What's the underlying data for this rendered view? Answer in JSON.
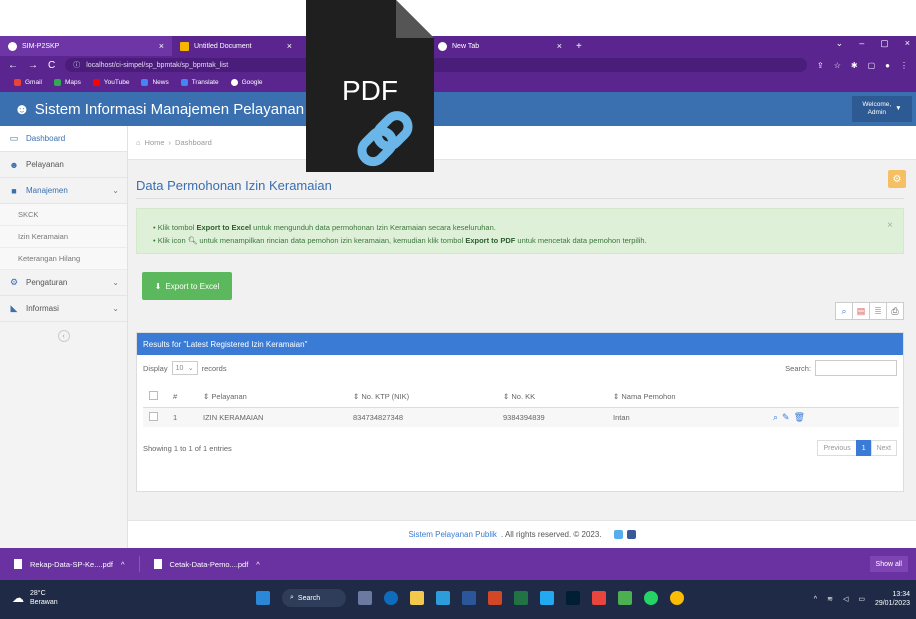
{
  "browser": {
    "tabs": [
      {
        "label": "SIM-P2SKP",
        "close": "×"
      },
      {
        "label": "Untitled Document",
        "close": "×"
      },
      {
        "label": "New Tab",
        "close": "×"
      }
    ],
    "new_tab": "+",
    "address": "localhost/ci-simpel/sp_bpmtak/sp_bpmtak_list",
    "address_host": "localhost",
    "window_controls": [
      "⌄",
      "–",
      "▢",
      "×"
    ],
    "bookmarks": [
      {
        "label": "Gmail",
        "color": "#ea4335"
      },
      {
        "label": "Maps",
        "color": "#34a853"
      },
      {
        "label": "YouTube",
        "color": "#ff0000"
      },
      {
        "label": "News",
        "color": "#4285f4"
      },
      {
        "label": "Translate",
        "color": "#4285f4"
      },
      {
        "label": "Google",
        "color": "#ffffff"
      }
    ]
  },
  "overlay": {
    "text": "PDF"
  },
  "header": {
    "title": "Sistem Informasi Manajemen Pelayanan Pelaya",
    "welcome": "Welcome,",
    "user": "Admin"
  },
  "sidebar": {
    "items": [
      {
        "label": "Dashboard"
      },
      {
        "label": "Pelayanan"
      },
      {
        "label": "Manajemen"
      },
      {
        "label": "Pengaturan"
      },
      {
        "label": "Informasi"
      }
    ],
    "subitems": [
      "SKCK",
      "Izin Keramaian",
      "Keterangan Hilang"
    ]
  },
  "breadcrumb": {
    "home": "Home",
    "sep": "›",
    "current": "Dashboard"
  },
  "page": {
    "title": "Data Permohonan Izin Keramaian"
  },
  "alert": {
    "line1_pre": "Klik tombol ",
    "line1_bold": "Export to Excel",
    "line1_post": " untuk mengunduh data permohonan Izin Keramaian secara keseluruhan.",
    "line2_pre": "Klik icon ",
    "line2_mid": " untuk menampilkan rincian data pemohon izin keramaian, kemudian klik tombol ",
    "line2_bold": "Export to PDF",
    "line2_post": " untuk mencetak data pemohon terpilih.",
    "close": "×"
  },
  "export_button": "Export to Excel",
  "results_title": "Results for \"Latest Registered Izin Keramaian\"",
  "controls": {
    "display": "Display",
    "records_count": "10",
    "records": "records",
    "search": "Search:"
  },
  "table": {
    "headers": [
      "#",
      "Pelayanan",
      "No. KTP (NIK)",
      "No. KK",
      "Nama Pemohon"
    ],
    "rows": [
      {
        "num": "1",
        "pelayanan": "IZIN KERAMAIAN",
        "ktp": "834734827348",
        "kk": "9384394839",
        "nama": "Intan"
      }
    ]
  },
  "info": "Showing 1 to 1 of 1 entries",
  "pager": {
    "prev": "Previous",
    "current": "1",
    "next": "Next"
  },
  "footer": {
    "brand": "Sistem Pelayanan Publik",
    "text": ". All rights reserved. © 2023."
  },
  "downloads": [
    {
      "label": "Rekap-Data-SP-Ke....pdf"
    },
    {
      "label": "Cetak-Data-Pemo....pdf"
    }
  ],
  "downloads_show_all": "Show all",
  "taskbar": {
    "temp": "28°C",
    "weather": "Berawan",
    "search": "Search",
    "time": "13:34",
    "date": "29/01/2023"
  },
  "colors": {
    "browser": "#5b2590",
    "header": "#3a6fb0",
    "panel_head": "#3a7bd5",
    "excel_button": "#5cb85c",
    "alert_bg": "#dff0d8"
  }
}
